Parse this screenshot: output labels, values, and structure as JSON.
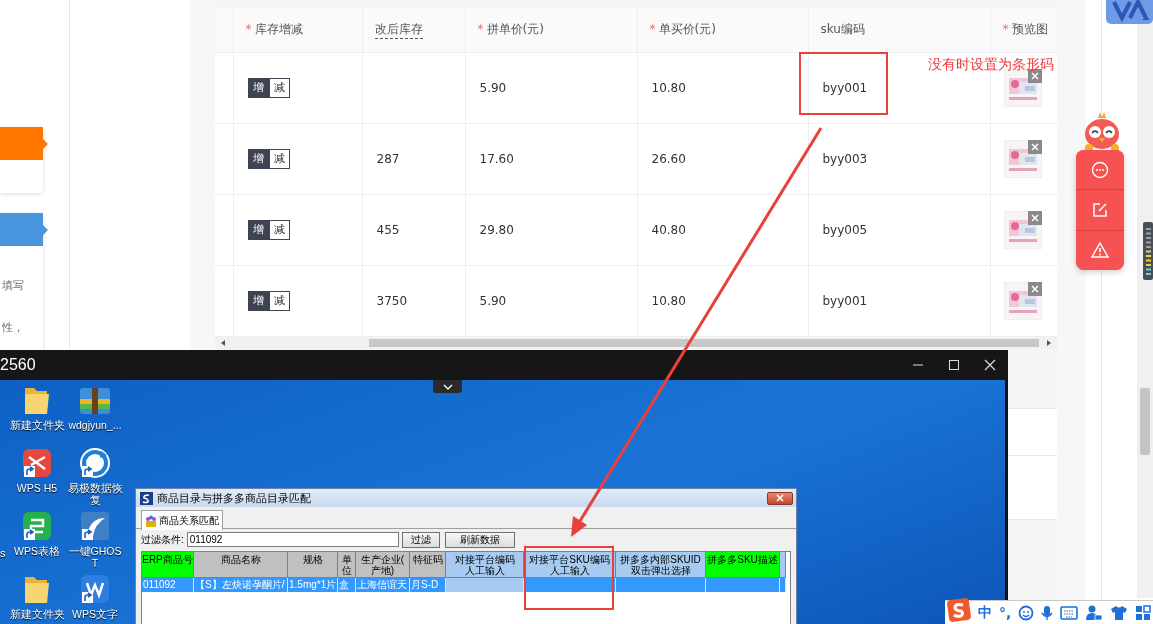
{
  "side_panel": {
    "cards": [
      {
        "color": "#ff7700"
      },
      {
        "color": "#4a95e0",
        "texts": [
          "填写",
          "性，"
        ]
      }
    ]
  },
  "sku_table": {
    "columns": [
      {
        "label": "库存增减",
        "required_mark": "*"
      },
      {
        "label": "改后库存",
        "hint_underline": true
      },
      {
        "label": "拼单价(元)",
        "required_mark": "*"
      },
      {
        "label": "单买价(元)",
        "required_mark": "*"
      },
      {
        "label": "sku编码"
      },
      {
        "label": "预览图",
        "required_mark": "*"
      }
    ],
    "rows": [
      {
        "stock_toggle": [
          {
            "label": "增",
            "selected": true
          },
          {
            "label": "减",
            "selected": false
          }
        ],
        "group_price": "5.90",
        "single_price": "10.80",
        "sku": "byy001"
      },
      {
        "stock_toggle": [
          {
            "label": "增",
            "selected": true
          },
          {
            "label": "减",
            "selected": false
          }
        ],
        "after_stock": "287",
        "group_price": "17.60",
        "single_price": "26.60",
        "sku": "byy003"
      },
      {
        "stock_toggle": [
          {
            "label": "增",
            "selected": true
          },
          {
            "label": "减",
            "selected": false
          }
        ],
        "after_stock": "455",
        "group_price": "29.80",
        "single_price": "40.80",
        "sku": "byy005"
      },
      {
        "stock_toggle": [
          {
            "label": "增",
            "selected": true
          },
          {
            "label": "减",
            "selected": false
          }
        ],
        "after_stock": "3750",
        "group_price": "5.90",
        "single_price": "10.80",
        "sku": "byy001"
      }
    ]
  },
  "annotation": {
    "note": "没有时设置为条形码"
  },
  "remote_window": {
    "title": "2560",
    "desktop_icons": [
      {
        "label": "新建文件夹",
        "kind": "folder",
        "shortcut": false
      },
      {
        "label": "wdgjyun_...",
        "kind": "archive",
        "shortcut": false
      },
      {
        "label": "WPS H5",
        "kind": "wps-h5",
        "shortcut": true
      },
      {
        "label": "易极数据恢复",
        "kind": "recovery",
        "shortcut": true
      },
      {
        "label": "WPS表格",
        "kind": "wps-sheet",
        "shortcut": true
      },
      {
        "label": "一键GHOST",
        "kind": "ghost",
        "shortcut": true
      },
      {
        "label": "新建文件夹",
        "kind": "folder",
        "shortcut": false
      },
      {
        "label": "WPS文字",
        "kind": "wps-writer",
        "shortcut": true
      }
    ],
    "cut_label": "s",
    "dialog": {
      "title": "商品目录与拼多多商品目录匹配",
      "tabs": [
        {
          "label": "商品关系匹配",
          "selected": true
        }
      ],
      "filter": {
        "label": "过滤条件:",
        "value": "011092"
      },
      "buttons": [
        "过滤",
        "刷新数据"
      ],
      "grid": {
        "columns": [
          {
            "lines": [
              "ERP商品号"
            ],
            "color": "#00ff00"
          },
          {
            "lines": [
              "商品名称"
            ],
            "color": "#c0c0c0"
          },
          {
            "lines": [
              "规格"
            ],
            "color": "#c0c0c0"
          },
          {
            "lines": [
              "单",
              "位"
            ],
            "color": "#c0c0c0"
          },
          {
            "lines": [
              "生产企业(",
              "产地)"
            ],
            "color": "#c0c0c0"
          },
          {
            "lines": [
              "特征码"
            ],
            "color": "#c0c0c0"
          },
          {
            "lines": [
              "对接平台编码",
              "人工输入"
            ],
            "color": "#a6caf0"
          },
          {
            "lines": [
              "对接平台SKU编码",
              "人工输入"
            ],
            "color": "#a6caf0"
          },
          {
            "lines": [
              "拼多多内部SKUID",
              "双击弹出选择"
            ],
            "color": "#a6caf0"
          },
          {
            "lines": [
              "拼多多SKU描述"
            ],
            "color": "#00ff00"
          },
          {
            "color": "#a6caf0"
          }
        ],
        "rows": [
          {
            "selected": true,
            "cells": [
              {
                "text": "011092",
                "focused": false
              },
              {
                "text": "【S】左炔诺孕酮片/",
                "focused": false
              },
              {
                "text": "1.5mg*1片",
                "focused": false
              },
              {
                "text": "盒",
                "focused": false
              },
              {
                "text": "上海信谊天",
                "focused": false
              },
              {
                "text": "月S-D",
                "focused": false
              },
              {
                "focused": true
              },
              {
                "focused": false
              },
              {
                "focused": false
              },
              {
                "focused": false
              },
              {
                "focused": false
              }
            ]
          }
        ]
      }
    }
  },
  "ime_bar": {
    "items": [
      {
        "kind": "logo"
      },
      {
        "kind": "text",
        "text": "中"
      },
      {
        "kind": "text",
        "text": "°,"
      },
      {
        "kind": "smiley"
      },
      {
        "kind": "mic"
      },
      {
        "kind": "keyboard"
      },
      {
        "kind": "person"
      },
      {
        "kind": "shirt"
      },
      {
        "kind": "grid"
      }
    ]
  }
}
